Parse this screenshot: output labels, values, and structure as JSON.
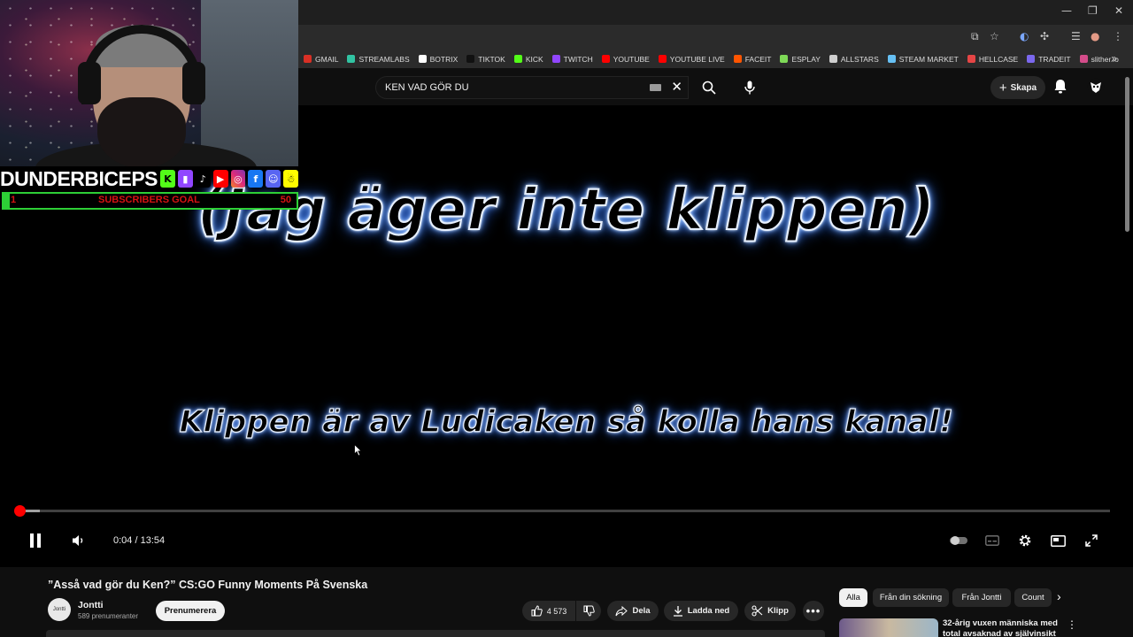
{
  "streamer_overlay": {
    "brand": "DUNDERBICEPS",
    "socials": [
      "kick-icon",
      "twitch-icon",
      "tiktok-icon",
      "youtube-icon",
      "instagram-icon",
      "facebook-icon",
      "discord-icon",
      "snapchat-icon"
    ],
    "goal": {
      "current": "1",
      "label": "SUBSCRIBERS GOAL",
      "target": "50",
      "progress_fraction": 0.02
    }
  },
  "bookmarks": [
    {
      "label": "GMAIL",
      "color": "#d93025"
    },
    {
      "label": "STREAMLABS",
      "color": "#31c3a2"
    },
    {
      "label": "BOTRIX",
      "color": "#ffffff"
    },
    {
      "label": "TIKTOK",
      "color": "#111111"
    },
    {
      "label": "KICK",
      "color": "#53fc18"
    },
    {
      "label": "TWITCH",
      "color": "#9146ff"
    },
    {
      "label": "YOUTUBE",
      "color": "#ff0000"
    },
    {
      "label": "YOUTUBE LIVE",
      "color": "#ff0000"
    },
    {
      "label": "FACEIT",
      "color": "#ff5500"
    },
    {
      "label": "ESPLAY",
      "color": "#7ed957"
    },
    {
      "label": "ALLSTARS",
      "color": "#cfcfcf"
    },
    {
      "label": "STEAM MARKET",
      "color": "#66c0f4"
    },
    {
      "label": "HELLCASE",
      "color": "#e64545"
    },
    {
      "label": "TRADEIT",
      "color": "#7b68ee"
    },
    {
      "label": "slither.io",
      "color": "#d44c8a"
    }
  ],
  "masthead": {
    "search_value": "KEN VAD GÖR DU",
    "create_label": "Skapa"
  },
  "video": {
    "subtitle_top": "(Jag äger inte klippen)",
    "subtitle_bottom": "Klippen är av Ludicaken så kolla hans kanal!",
    "current_time": "0:04",
    "duration": "13:54",
    "time_display": "0:04 / 13:54",
    "played_fraction": 0.005,
    "buffered_fraction": 0.02
  },
  "details": {
    "title": "”Asså vad gör du Ken?” CS:GO Funny Moments På Svenska",
    "channel_name": "Jontti",
    "channel_avatar_text": "Jontti",
    "subscribers": "589 prenumeranter",
    "subscribe_label": "Prenumerera",
    "likes": "4 573",
    "share_label": "Dela",
    "download_label": "Ladda ned",
    "clip_label": "Klipp"
  },
  "filter_chips": [
    {
      "label": "Alla",
      "active": true
    },
    {
      "label": "Från din sökning",
      "active": false
    },
    {
      "label": "Från Jontti",
      "active": false
    },
    {
      "label": "Count",
      "active": false
    }
  ],
  "recommendation": {
    "title": "32-årig vuxen människa med total avsaknad av självinsikt"
  }
}
